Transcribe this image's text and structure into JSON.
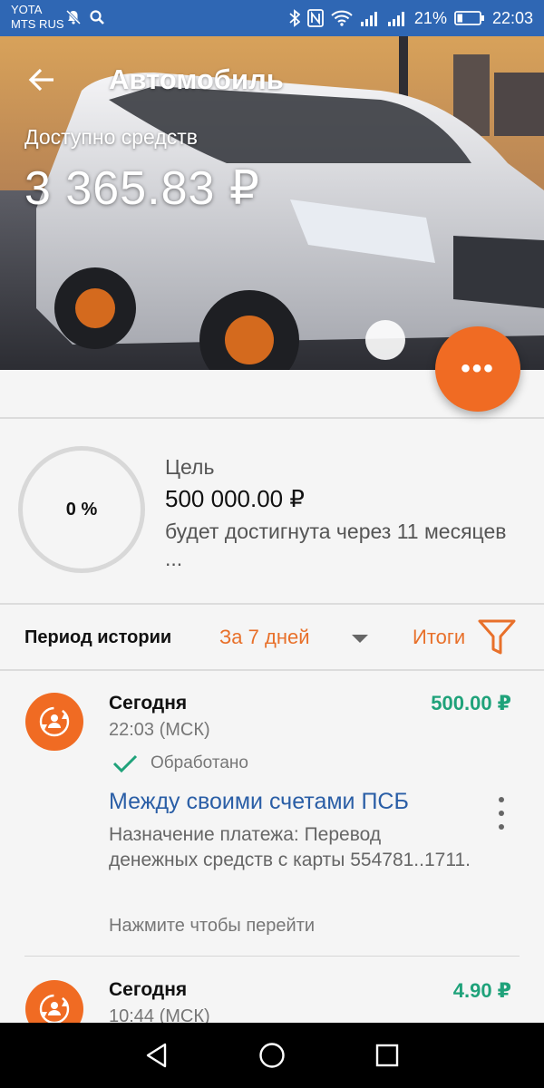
{
  "status_bar": {
    "carrier_1": "YOTA",
    "carrier_2": "MTS RUS",
    "battery": "21%",
    "time": "22:03",
    "icons": [
      "mute-bell-icon",
      "search-icon",
      "bluetooth-icon",
      "nfc-icon",
      "wifi-icon",
      "signal-icon",
      "signal-icon",
      "battery-icon"
    ]
  },
  "hero": {
    "title": "Автомобиль",
    "available_label": "Доступно средств",
    "available_amount": "3 365.83 ₽"
  },
  "fab": {
    "label": "•••",
    "icon": "more-horizontal-icon"
  },
  "goal": {
    "progress_label": "0 %",
    "progress": 0,
    "label": "Цель",
    "amount": "500 000.00 ₽",
    "note": "будет достигнута через 11 месяцев ..."
  },
  "history": {
    "period_label": "Период истории",
    "period_value": "За 7 дней",
    "totals_label": "Итоги"
  },
  "transactions": [
    {
      "date": "Сегодня",
      "time": "22:03 (МСК)",
      "amount": "500.00 ₽",
      "status": "Обработано",
      "title": "Между своими счетами ПСБ",
      "description": "Назначение платежа: Перевод денежных средств с карты 554781..1711.",
      "hint": "Нажмите чтобы перейти"
    },
    {
      "date": "Сегодня",
      "time": "10:44 (МСК)",
      "amount": "4.90 ₽"
    }
  ],
  "colors": {
    "status_bar": "#2f67b4",
    "accent": "#f06b23",
    "positive_amount": "#1fa27a",
    "link": "#2a5ea6"
  }
}
